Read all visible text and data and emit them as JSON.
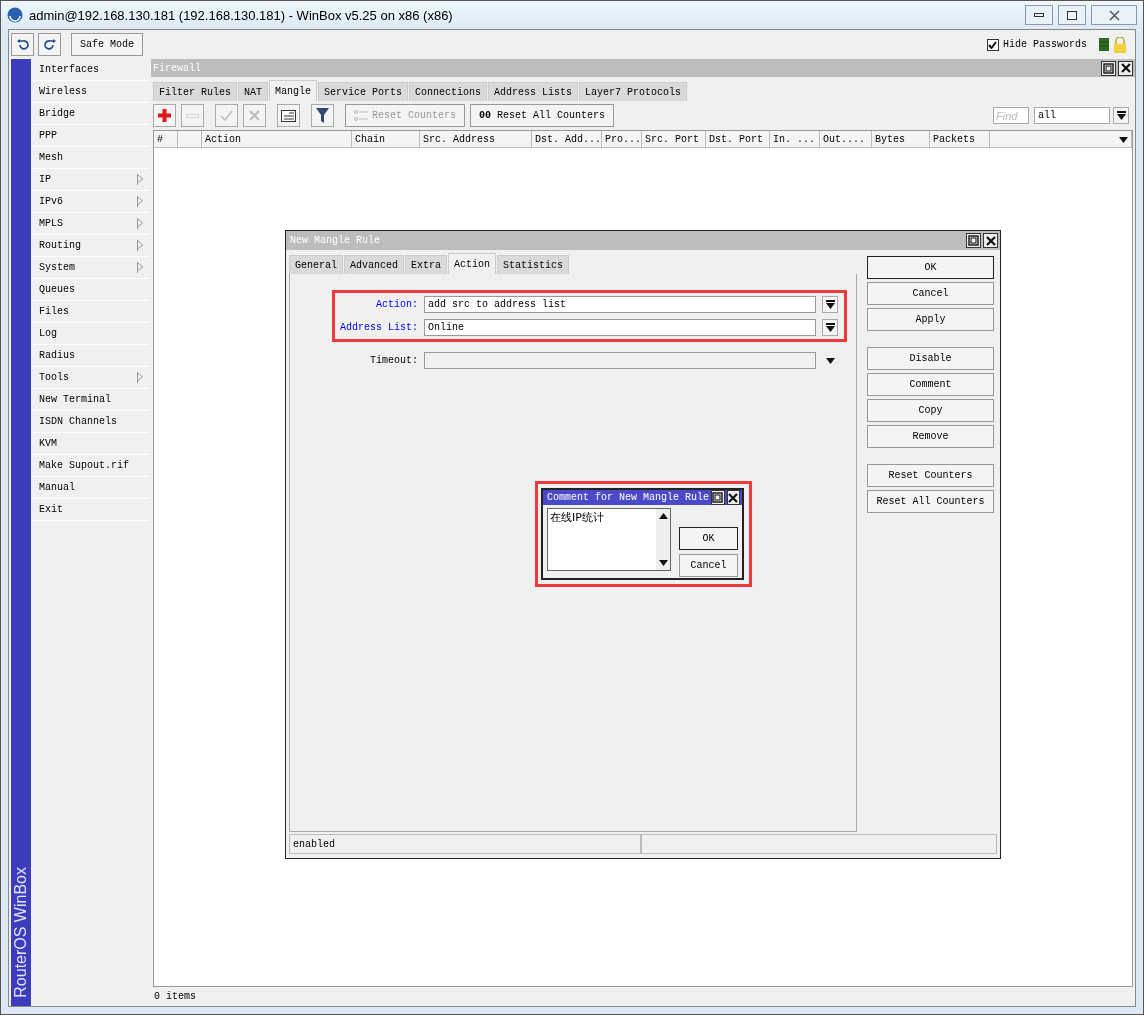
{
  "window": {
    "title": "admin@192.168.130.181 (192.168.130.181) - WinBox v5.25 on x86 (x86)"
  },
  "toolbar": {
    "buttons": [
      {
        "kind": "undo"
      },
      {
        "kind": "redo"
      }
    ],
    "safe_mode": "Safe Mode",
    "hide_passwords": {
      "label": "Hide Passwords",
      "checked": true
    }
  },
  "sidebar": {
    "brand": "RouterOS WinBox",
    "items": [
      {
        "label": "Interfaces",
        "submenu": false
      },
      {
        "label": "Wireless",
        "submenu": false
      },
      {
        "label": "Bridge",
        "submenu": false
      },
      {
        "label": "PPP",
        "submenu": false
      },
      {
        "label": "Mesh",
        "submenu": false
      },
      {
        "label": "IP",
        "submenu": true
      },
      {
        "label": "IPv6",
        "submenu": true
      },
      {
        "label": "MPLS",
        "submenu": true
      },
      {
        "label": "Routing",
        "submenu": true
      },
      {
        "label": "System",
        "submenu": true
      },
      {
        "label": "Queues",
        "submenu": false
      },
      {
        "label": "Files",
        "submenu": false
      },
      {
        "label": "Log",
        "submenu": false
      },
      {
        "label": "Radius",
        "submenu": false
      },
      {
        "label": "Tools",
        "submenu": true
      },
      {
        "label": "New Terminal",
        "submenu": false
      },
      {
        "label": "ISDN Channels",
        "submenu": false
      },
      {
        "label": "KVM",
        "submenu": false
      },
      {
        "label": "Make Supout.rif",
        "submenu": false
      },
      {
        "label": "Manual",
        "submenu": false
      },
      {
        "label": "Exit",
        "submenu": false
      }
    ]
  },
  "firewall": {
    "title": "Firewall",
    "tabs": [
      {
        "label": "Filter Rules",
        "selected": false
      },
      {
        "label": "NAT",
        "selected": false
      },
      {
        "label": "Mangle",
        "selected": true
      },
      {
        "label": "Service Ports",
        "selected": false
      },
      {
        "label": "Connections",
        "selected": false
      },
      {
        "label": "Address Lists",
        "selected": false
      },
      {
        "label": "Layer7 Protocols",
        "selected": false
      }
    ],
    "tools": [
      {
        "kind": "add",
        "disabled": false
      },
      {
        "kind": "remove",
        "disabled": true
      },
      {
        "kind": "enable",
        "disabled": true
      },
      {
        "kind": "disable",
        "disabled": true
      },
      {
        "kind": "comment",
        "disabled": false
      },
      {
        "kind": "filter",
        "disabled": false
      },
      {
        "kind": "reset",
        "label": "Reset Counters",
        "disabled": true
      },
      {
        "kind": "reset-all",
        "label": "**00** Reset All Counters",
        "disabled": false
      }
    ],
    "find": {
      "placeholder": "Find"
    },
    "filter_value": "all",
    "columns": [
      "#",
      "Action",
      "Chain",
      "Src. Address",
      "Dst. Add...",
      "Pro...",
      "Src. Port",
      "Dst. Port",
      "In. ...",
      "Out....",
      "Bytes",
      "Packets"
    ],
    "status": "0 items"
  },
  "rule_dialog": {
    "title": "New Mangle Rule",
    "tabs": [
      {
        "label": "General",
        "selected": false
      },
      {
        "label": "Advanced",
        "selected": false
      },
      {
        "label": "Extra",
        "selected": false
      },
      {
        "label": "Action",
        "selected": true
      },
      {
        "label": "Statistics",
        "selected": false
      }
    ],
    "field_groups": [
      {
        "highlighted": true,
        "fields": [
          {
            "label": "Action:",
            "value": "add src to address list",
            "set": true,
            "kind": "select"
          },
          {
            "label": "Address List:",
            "value": "Online",
            "set": true,
            "kind": "select"
          }
        ]
      },
      {
        "highlighted": false,
        "fields": [
          {
            "label": "Timeout:",
            "set": false,
            "kind": "optional"
          }
        ]
      }
    ],
    "button_groups": [
      [
        "OK",
        "Cancel",
        "Apply"
      ],
      [
        "Disable",
        "Comment",
        "Copy",
        "Remove"
      ],
      [
        "Reset Counters",
        "Reset All Counters"
      ]
    ],
    "status": "enabled"
  },
  "comment_dialog": {
    "title": "Comment for New Mangle Rule",
    "value": "在线IP统计",
    "highlighted": true,
    "buttons": [
      "OK",
      "Cancel"
    ]
  }
}
